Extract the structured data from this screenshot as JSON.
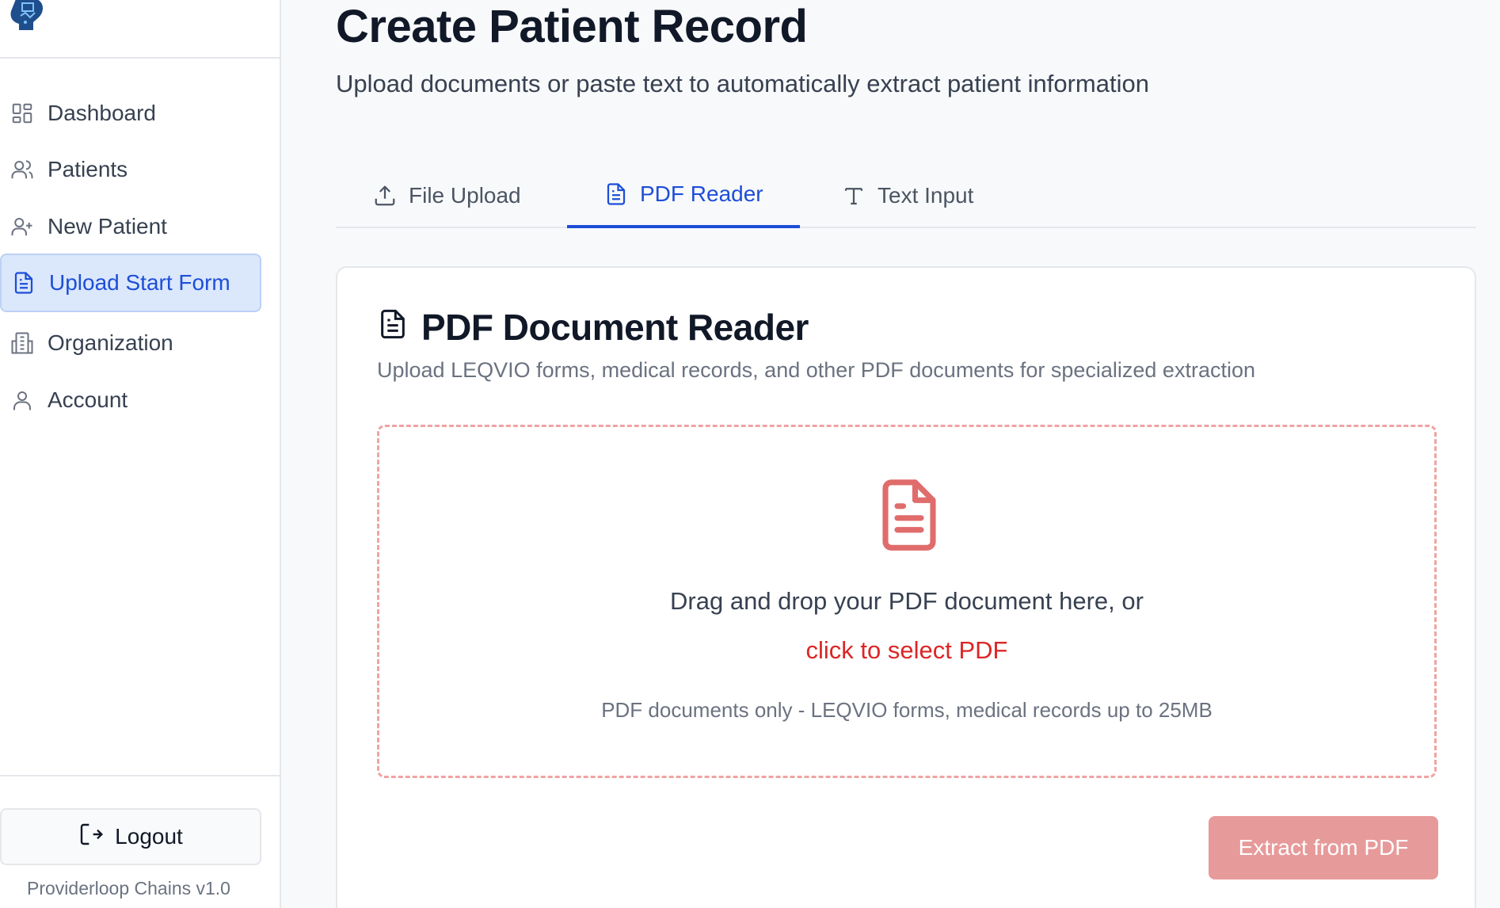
{
  "sidebar": {
    "items": [
      {
        "label": "Dashboard",
        "icon": "dashboard-grid-icon"
      },
      {
        "label": "Patients",
        "icon": "users-icon"
      },
      {
        "label": "New Patient",
        "icon": "user-plus-icon"
      },
      {
        "label": "Upload Start Form",
        "icon": "file-text-icon",
        "active": true
      },
      {
        "label": "Organization",
        "icon": "building-icon"
      },
      {
        "label": "Account",
        "icon": "user-icon"
      }
    ],
    "logout_label": "Logout",
    "version": "Providerloop Chains v1.0"
  },
  "header": {
    "title": "Create Patient Record",
    "subtitle": "Upload documents or paste text to automatically extract patient information"
  },
  "tabs": [
    {
      "label": "File Upload",
      "icon": "upload-icon"
    },
    {
      "label": "PDF Reader",
      "icon": "file-text-icon",
      "active": true
    },
    {
      "label": "Text Input",
      "icon": "text-type-icon"
    }
  ],
  "card": {
    "title": "PDF Document Reader",
    "subtitle": "Upload LEQVIO forms, medical records, and other PDF documents for specialized extraction",
    "dropzone": {
      "prompt": "Drag and drop your PDF document here, or",
      "link": "click to select PDF",
      "note": "PDF documents only - LEQVIO forms, medical records up to 25MB"
    },
    "extract_label": "Extract from PDF"
  },
  "colors": {
    "accent": "#1d4ed8",
    "active_bg": "#dbe7fb",
    "danger": "#dc2626",
    "dropzone_border": "#f0a3a3",
    "extract_button": "#e79a9a"
  }
}
